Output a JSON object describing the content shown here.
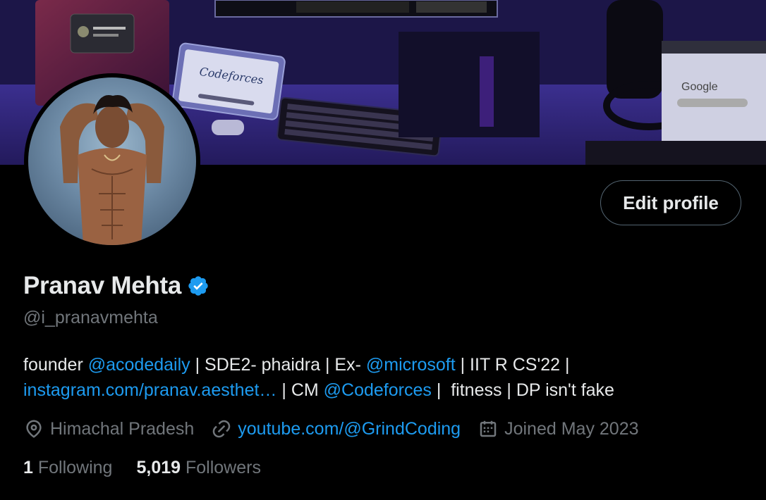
{
  "profile": {
    "name": "Pranav Mehta",
    "handle": "@i_pranavmehta",
    "edit_button_label": "Edit profile",
    "banner": {
      "tablet_text": "Codeforces",
      "monitor_text": "Google"
    }
  },
  "bio": {
    "segments": [
      {
        "text": "founder ",
        "link": false
      },
      {
        "text": "@acodedaily",
        "link": true
      },
      {
        "text": " | SDE2- phaidra | Ex- ",
        "link": false
      },
      {
        "text": "@microsoft",
        "link": true
      },
      {
        "text": " | IIT R CS'22 |",
        "link": false
      },
      {
        "text": "instagram.com/pranav.aesthet…",
        "link": true
      },
      {
        "text": " | CM ",
        "link": false
      },
      {
        "text": "@Codeforces",
        "link": true
      },
      {
        "text": " |  fitness | DP isn't fake",
        "link": false
      }
    ]
  },
  "meta": {
    "location": "Himachal Pradesh",
    "website": "youtube.com/@GrindCoding",
    "joined": "Joined May 2023"
  },
  "stats": {
    "following_count": "1",
    "following_label": "Following",
    "followers_count": "5,019",
    "followers_label": "Followers"
  },
  "colors": {
    "background": "#000000",
    "text_primary": "#e7e9ea",
    "text_secondary": "#71767b",
    "link": "#1d9bf0",
    "verified": "#1d9bf0",
    "button_border": "#536471"
  },
  "icons": [
    "verified-badge-icon",
    "location-pin-icon",
    "link-icon",
    "calendar-icon"
  ]
}
